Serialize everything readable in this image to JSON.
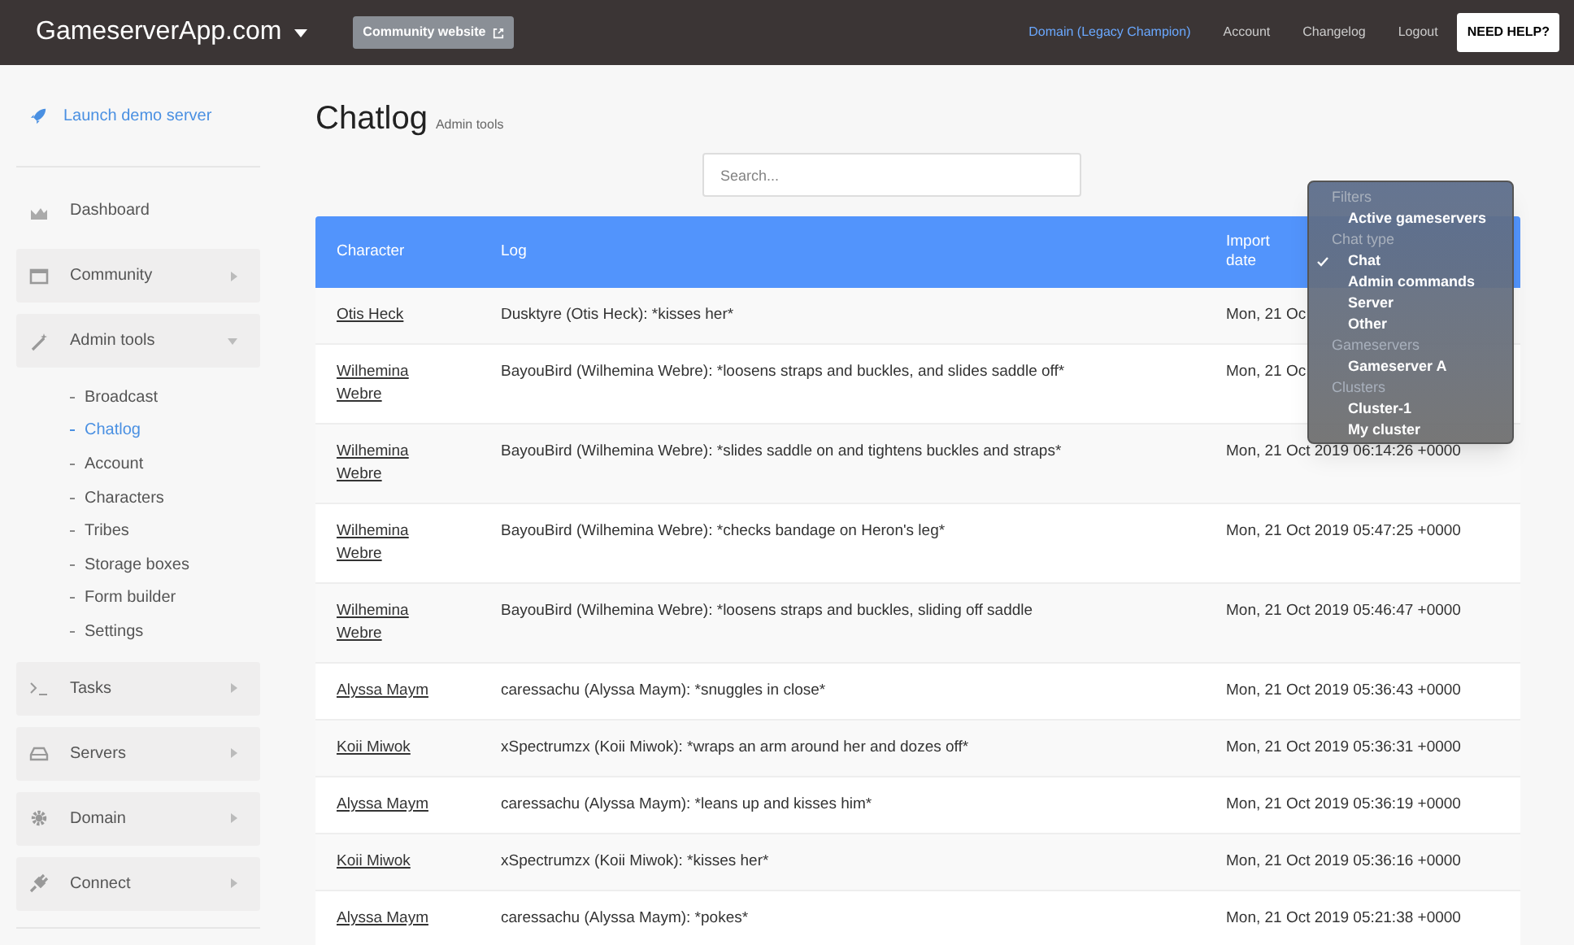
{
  "topbar": {
    "brand": "GameserverApp.com",
    "community_button": "Community website",
    "links": [
      {
        "label": "Domain (Legacy Champion)",
        "selected": true
      },
      {
        "label": "Account",
        "selected": false
      },
      {
        "label": "Changelog",
        "selected": false
      },
      {
        "label": "Logout",
        "selected": false
      }
    ],
    "help_button": "NEED HELP?"
  },
  "sidebar": {
    "launch": "Launch demo server",
    "items": [
      {
        "kind": "link",
        "label": "Dashboard"
      },
      {
        "kind": "group",
        "label": "Community",
        "expanded": false
      },
      {
        "kind": "group",
        "label": "Admin tools",
        "expanded": true,
        "children": [
          {
            "label": "Broadcast",
            "selected": false
          },
          {
            "label": "Chatlog",
            "selected": true
          },
          {
            "label": "Account",
            "selected": false
          },
          {
            "label": "Characters",
            "selected": false
          },
          {
            "label": "Tribes",
            "selected": false
          },
          {
            "label": "Storage boxes",
            "selected": false
          },
          {
            "label": "Form builder",
            "selected": false
          },
          {
            "label": "Settings",
            "selected": false
          }
        ]
      },
      {
        "kind": "group",
        "label": "Tasks",
        "expanded": false
      },
      {
        "kind": "group",
        "label": "Servers",
        "expanded": false
      },
      {
        "kind": "group",
        "label": "Domain",
        "expanded": false
      },
      {
        "kind": "group",
        "label": "Connect",
        "expanded": false
      }
    ]
  },
  "page": {
    "title": "Chatlog",
    "subtitle": "Admin tools"
  },
  "search": {
    "placeholder": "Search..."
  },
  "table": {
    "columns": [
      "Character",
      "Log",
      "Import date"
    ],
    "rows": [
      {
        "character": "Otis Heck",
        "log": "Dusktyre (Otis Heck): *kisses her*",
        "date": "Mon, 21 Oc"
      },
      {
        "character": "Wilhemina Webre",
        "log": "BayouBird (Wilhemina Webre): *loosens straps and buckles, and slides saddle off*",
        "date": "Mon, 21 Oc"
      },
      {
        "character": "Wilhemina Webre",
        "log": "BayouBird (Wilhemina Webre): *slides saddle on and tightens buckles and straps*",
        "date": "Mon, 21 Oct 2019 06:14:26 +0000"
      },
      {
        "character": "Wilhemina Webre",
        "log": "BayouBird (Wilhemina Webre): *checks bandage on Heron's leg*",
        "date": "Mon, 21 Oct 2019 05:47:25 +0000"
      },
      {
        "character": "Wilhemina Webre",
        "log": "BayouBird (Wilhemina Webre): *loosens straps and buckles, sliding off saddle",
        "date": "Mon, 21 Oct 2019 05:46:47 +0000"
      },
      {
        "character": "Alyssa Maym",
        "log": "caressachu (Alyssa Maym): *snuggles in close*",
        "date": "Mon, 21 Oct 2019 05:36:43 +0000"
      },
      {
        "character": "Koii Miwok",
        "log": "xSpectrumzx (Koii Miwok): *wraps an arm around her and dozes off*",
        "date": "Mon, 21 Oct 2019 05:36:31 +0000"
      },
      {
        "character": "Alyssa Maym",
        "log": "caressachu (Alyssa Maym): *leans up and kisses him*",
        "date": "Mon, 21 Oct 2019 05:36:19 +0000"
      },
      {
        "character": "Koii Miwok",
        "log": "xSpectrumzx (Koii Miwok): *kisses her*",
        "date": "Mon, 21 Oct 2019 05:36:16 +0000"
      },
      {
        "character": "Alyssa Maym",
        "log": "caressachu (Alyssa Maym): *pokes*",
        "date": "Mon, 21 Oct 2019 05:21:38 +0000"
      }
    ]
  },
  "filter_menu": {
    "items": [
      {
        "kind": "header",
        "label": "Filters"
      },
      {
        "kind": "option",
        "label": "Active gameservers",
        "checked": false
      },
      {
        "kind": "header",
        "label": "Chat type"
      },
      {
        "kind": "option",
        "label": "Chat",
        "checked": true
      },
      {
        "kind": "option",
        "label": "Admin commands",
        "checked": false
      },
      {
        "kind": "option",
        "label": "Server",
        "checked": false
      },
      {
        "kind": "option",
        "label": "Other",
        "checked": false
      },
      {
        "kind": "header",
        "label": "Gameservers"
      },
      {
        "kind": "option",
        "label": "Gameserver A",
        "checked": false
      },
      {
        "kind": "header",
        "label": "Clusters"
      },
      {
        "kind": "option",
        "label": "Cluster-1",
        "checked": false
      },
      {
        "kind": "option",
        "label": "My cluster",
        "checked": false
      }
    ]
  }
}
